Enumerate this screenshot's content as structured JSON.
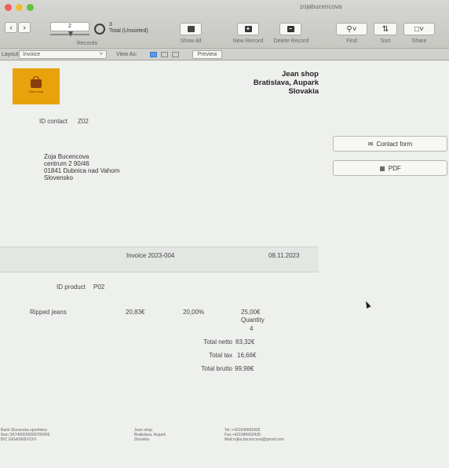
{
  "window": {
    "title": "zojabucencova"
  },
  "toolbar": {
    "records_label": "Records",
    "record_number": "2",
    "total_count": "3",
    "total_status": "Total (Unsorted)",
    "show_all_label": "Show All",
    "new_record_label": "New Record",
    "delete_record_label": "Delete Record",
    "find_label": "Find",
    "sort_label": "Sort",
    "share_label": "Share"
  },
  "layoutbar": {
    "layout_label": "Layout:",
    "layout_value": "Invoice",
    "view_as_label": "View As:",
    "preview_label": "Preview"
  },
  "header": {
    "logo_text": "Jean shop",
    "shop_name": "Jean shop",
    "shop_city": "Bratislava, Aupark",
    "shop_country": "Slovakia"
  },
  "contact": {
    "id_label": "ID contact",
    "id_value": "Z02",
    "name": "Zoja  Bucencova",
    "street": "centrum 2 90/46",
    "city": "01841  Dubnica nad Vahom",
    "country": "Slovensko"
  },
  "buttons": {
    "contact_form": "Contact form",
    "pdf": "PDF"
  },
  "invoice": {
    "number": "Invoice 2023-004",
    "date": "08.11.2023"
  },
  "product": {
    "id_label": "ID product",
    "id_value": "P02",
    "name": "Ripped jeans",
    "net_price": "20,83€",
    "vat": "20,00%",
    "gross_price": "25,00€",
    "quantity_label": "Quantity",
    "quantity": "4"
  },
  "totals": {
    "netto_label": "Total netto",
    "netto": "83,32€",
    "tax_label": "Total tax",
    "tax": "16,66€",
    "brutto_label": "Total brutto",
    "brutto": "99,98€"
  },
  "footer": {
    "bank": "Bank Slovenska sporitelna",
    "iban": "Iban SK7400000000789456",
    "bic": "BIC GIGASKBXXXX",
    "shop": "Jean shop",
    "shop_city": "Bratislava, Aupark",
    "shop_country": "Slovakia",
    "tel": "Tel.:+421940692435",
    "fax": "Fax:+421940692435",
    "mail": "Mail:zojka.bucencova@gmail.com"
  },
  "icons": {
    "prev": "chevron-left-icon",
    "next": "chevron-right-icon",
    "search": "magnifier-icon",
    "sort": "sort-icon",
    "share": "share-icon",
    "contact_form": "envelope-icon",
    "pdf": "document-icon"
  },
  "colors": {
    "logo": "#e8a20c",
    "background": "#eef0ed"
  }
}
